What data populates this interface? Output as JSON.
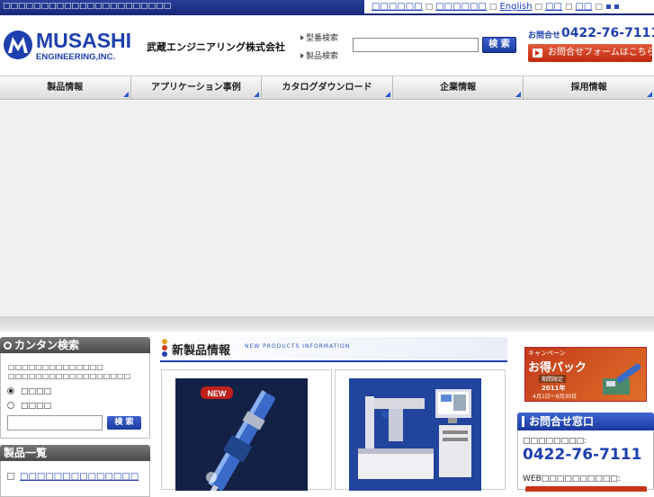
{
  "topbar": {
    "tagline": "□□□□□□□□□□□□□□□□□□□□□□",
    "links": [
      "□□□□□□",
      "□□□□□□",
      "English",
      "□□",
      "□□"
    ],
    "separators": [
      "□",
      "□",
      "□",
      "□",
      "□"
    ]
  },
  "header": {
    "logo_text": "MUSASHI",
    "logo_sub": "ENGINEERING,INC.",
    "company_name": "武蔵エンジニアリング株式会社",
    "search": {
      "option_model": "型番検索",
      "option_product": "製品検索",
      "button": "検 索",
      "value": ""
    },
    "contact": {
      "label": "お問合せ",
      "tel": "0422-76-7111",
      "form_button": "お問合せフォームはこちら"
    }
  },
  "nav": {
    "items": [
      "製品情報",
      "アプリケーション事例",
      "カタログダウンロード",
      "企業情報",
      "採用情報"
    ],
    "accent": "#2b57c9"
  },
  "sidebar": {
    "quick_search": {
      "title": "カンタン検索",
      "desc_line1": "□□□□□□□□□□□□□□",
      "desc_line2": "□□□□□□□□□□□□□□□□□□",
      "option1": "□□□□",
      "option2": "□□□□",
      "button": "検 索",
      "value": ""
    },
    "product_list": {
      "title": "製品一覧",
      "items": [
        "□□□□□□□□□□□□□□"
      ]
    }
  },
  "main": {
    "new_products": {
      "title": "新製品情報",
      "subtitle": "NEW PRODUCTS INFORMATION",
      "badge": "NEW"
    }
  },
  "right": {
    "campaign": {
      "label": "キャンペーン",
      "title": "お得パック",
      "tag": "期間限定",
      "year": "2011年",
      "period": "4月1日～9月30日"
    },
    "contact_window": {
      "title": "お問合せ窓口",
      "tel_label": "□□□□□□□□:",
      "tel": "0422-76-7111",
      "web_label": "WEB□□□□□□□□□□:"
    }
  },
  "colors": {
    "brand_blue": "#1e3fae",
    "topbar": "#17287a",
    "contact_red": "#c02a10"
  }
}
